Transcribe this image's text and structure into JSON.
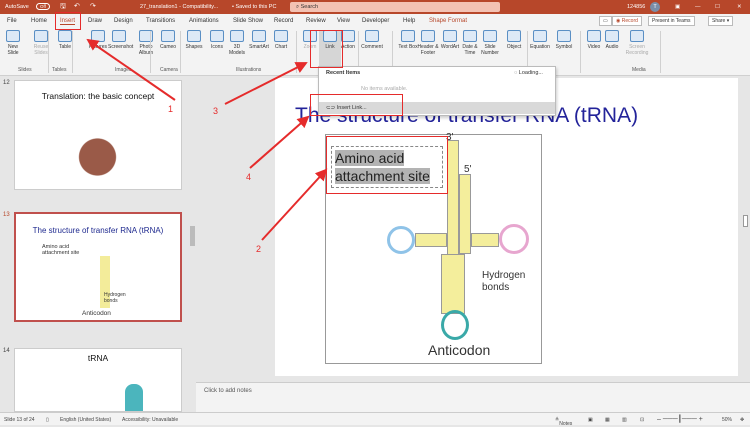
{
  "titlebar": {
    "autosave": "AutoSave",
    "autosave_state": "Off",
    "filename": "27_translation1 - Compatibility...",
    "saved": "• Saved to this PC",
    "search_placeholder": "Search",
    "user": "124856",
    "avatar": "T",
    "accent": "#b7472a"
  },
  "tabs": [
    "File",
    "Home",
    "Insert",
    "Draw",
    "Design",
    "Transitions",
    "Animations",
    "Slide Show",
    "Record",
    "Review",
    "View",
    "Developer",
    "Help",
    "Shape Format"
  ],
  "actions": {
    "record": "Record",
    "present": "Present in Teams",
    "share": "Share"
  },
  "ribbon": {
    "buttons": [
      {
        "label": "New Slide",
        "icon": "new-slide-icon"
      },
      {
        "label": "Reuse Slides",
        "icon": "reuse-slides-icon"
      },
      {
        "label": "Table",
        "icon": "table-icon"
      },
      {
        "label": "Pictures",
        "icon": "pictures-icon"
      },
      {
        "label": "Screenshot",
        "icon": "screenshot-icon"
      },
      {
        "label": "Photo Album",
        "icon": "photo-album-icon"
      },
      {
        "label": "Cameo",
        "icon": "cameo-icon"
      },
      {
        "label": "Shapes",
        "icon": "shapes-icon"
      },
      {
        "label": "Icons",
        "icon": "icons-icon"
      },
      {
        "label": "3D Models",
        "icon": "3d-models-icon"
      },
      {
        "label": "SmartArt",
        "icon": "smartart-icon"
      },
      {
        "label": "Chart",
        "icon": "chart-icon"
      },
      {
        "label": "Zoom",
        "icon": "zoom-icon"
      },
      {
        "label": "Link",
        "icon": "link-icon"
      },
      {
        "label": "Action",
        "icon": "action-icon"
      },
      {
        "label": "Comment",
        "icon": "comment-icon"
      },
      {
        "label": "Text Box",
        "icon": "text-box-icon"
      },
      {
        "label": "Header & Footer",
        "icon": "header-footer-icon"
      },
      {
        "label": "WordArt",
        "icon": "wordart-icon"
      },
      {
        "label": "Date & Time",
        "icon": "date-time-icon"
      },
      {
        "label": "Slide Number",
        "icon": "slide-number-icon"
      },
      {
        "label": "Object",
        "icon": "object-icon"
      },
      {
        "label": "Equation",
        "icon": "equation-icon"
      },
      {
        "label": "Symbol",
        "icon": "symbol-icon"
      },
      {
        "label": "Video",
        "icon": "video-icon"
      },
      {
        "label": "Audio",
        "icon": "audio-icon"
      },
      {
        "label": "Screen Recording",
        "icon": "screen-recording-icon"
      }
    ],
    "groups": [
      "Slides",
      "Tables",
      "Images",
      "Camera",
      "Illustrations",
      "Media"
    ]
  },
  "dropdown": {
    "header": "Recent Items",
    "loading": "Loading...",
    "empty": "No items available.",
    "insert_link": "Insert Link..."
  },
  "thumbnails": [
    {
      "num": "12",
      "title": "Translation: the basic concept"
    },
    {
      "num": "13",
      "title": "The structure of transfer RNA (tRNA)",
      "sub1": "Amino acid attachment site",
      "sub2": "Hydrogen bonds",
      "sub3": "Anticodon"
    },
    {
      "num": "14",
      "title": "tRNA"
    }
  ],
  "slide": {
    "title": "The structure of transfer RNA (tRNA)",
    "textbox": "Amino acid attachment site",
    "three_prime": "3'",
    "five_prime": "5'",
    "hbonds": "Hydrogen bonds",
    "anticodon": "Anticodon"
  },
  "notes_placeholder": "Click to add notes",
  "annotations": [
    "1",
    "2",
    "3",
    "4"
  ],
  "status": {
    "slide": "Slide 13 of 24",
    "language": "English (United States)",
    "accessibility": "Accessibility: Unavailable",
    "notes": "Notes",
    "zoom": "50%"
  }
}
